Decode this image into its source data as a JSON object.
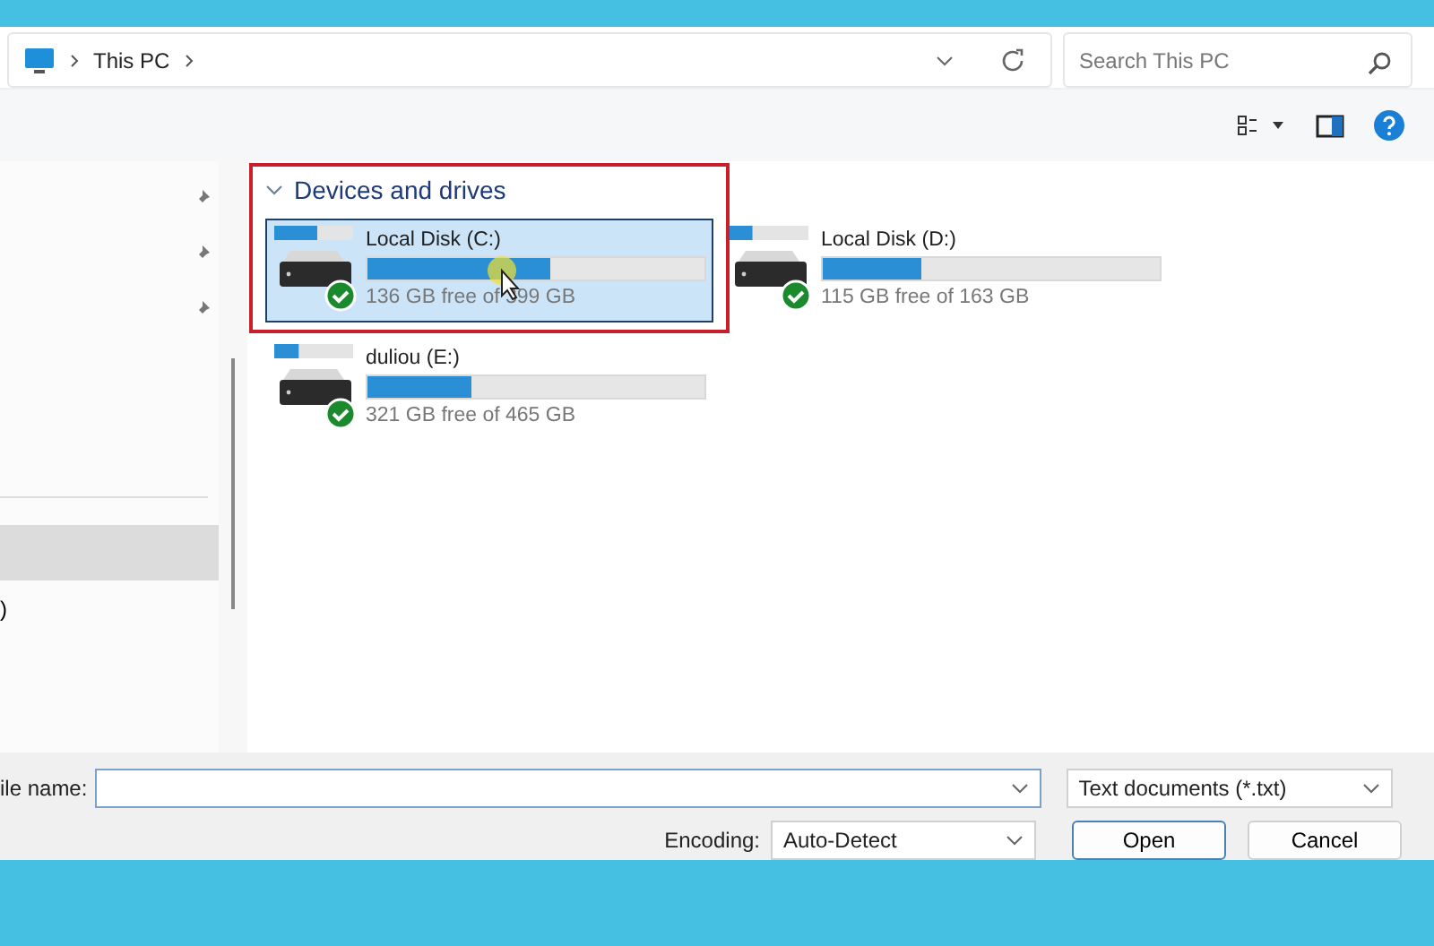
{
  "address_bar": {
    "path": [
      "This PC"
    ],
    "search": {
      "placeholder": "Search This PC"
    }
  },
  "nav_pane": {
    "items": [
      {
        "pinned": true,
        "selected": false
      },
      {
        "pinned": true,
        "selected": false
      },
      {
        "pinned": true,
        "selected": false
      },
      {
        "pinned": false,
        "selected": true
      },
      {
        "label": ")",
        "pinned": false,
        "selected": false
      }
    ]
  },
  "section": {
    "title": "Devices and drives",
    "expanded": true,
    "highlighted": true
  },
  "drives": [
    {
      "name": "Local Disk (C:)",
      "level": 0.545,
      "info": "136 GB free of 399 GB",
      "selected": true
    },
    {
      "name": "Local Disk (D:)",
      "level": 0.29,
      "info": "115 GB free of 163 GB",
      "selected": false
    },
    {
      "name": "duliou (E:)",
      "level": 0.31,
      "info": "321 GB free of 465 GB",
      "selected": false
    }
  ],
  "file_name": {
    "label": "ile name:"
  },
  "file_type": "Text documents (*.txt)",
  "encoding": {
    "label": "Encoding:",
    "value": "Auto-Detect"
  },
  "buttons": [
    "Open",
    "Cancel"
  ]
}
